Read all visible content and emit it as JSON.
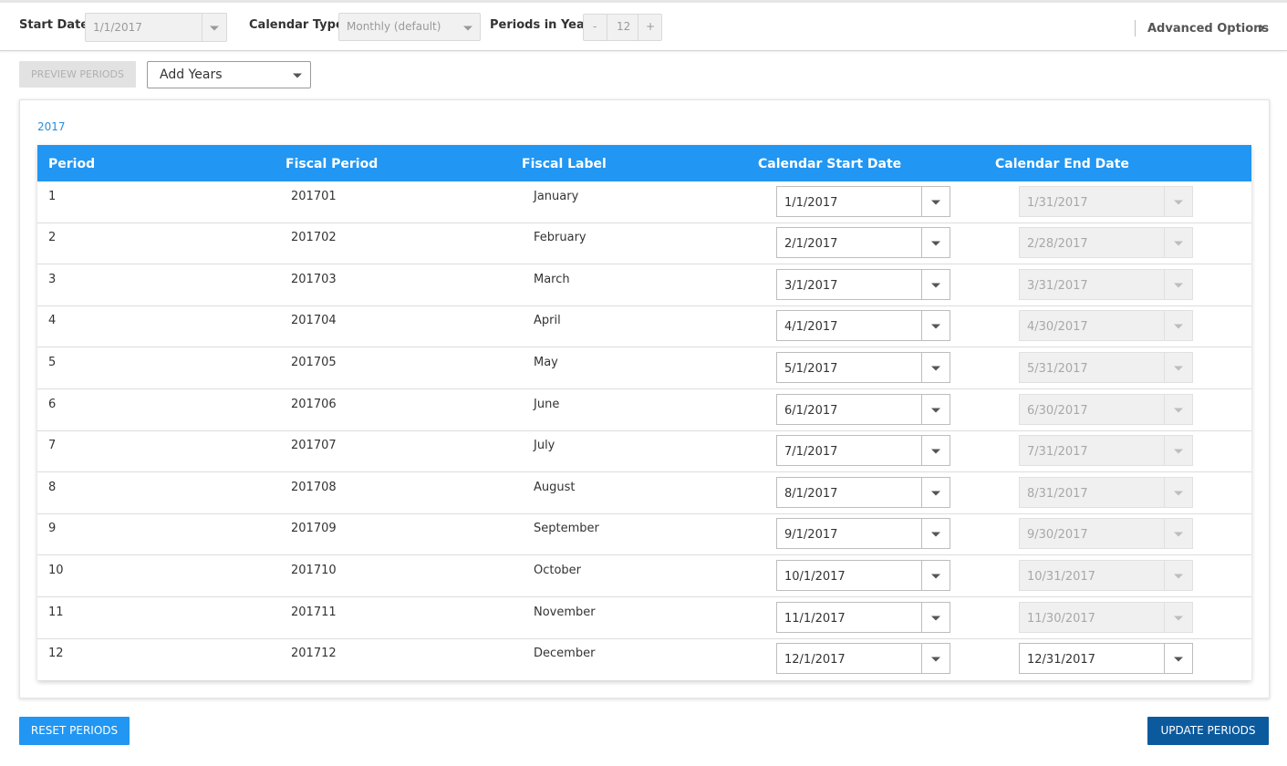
{
  "toolbar": {
    "start_date_label": "Start Date",
    "start_date_value": "1/1/2017",
    "calendar_type_label": "Calendar Type",
    "calendar_type_value": "Monthly (default)",
    "periods_label": "Periods in Year",
    "periods_minus": "-",
    "periods_value": "12",
    "periods_plus": "+",
    "advanced_options": "Advanced Options"
  },
  "actions": {
    "preview_label": "PREVIEW PERIODS",
    "add_years_value": "Add Years",
    "reset_label": "RESET PERIODS",
    "update_label": "UPDATE PERIODS"
  },
  "panel": {
    "year": "2017",
    "headers": {
      "period": "Period",
      "fiscal_period": "Fiscal Period",
      "fiscal_label": "Fiscal Label",
      "start_date": "Calendar Start Date",
      "end_date": "Calendar End Date"
    },
    "rows": [
      {
        "period": "1",
        "fiscal_period": "201701",
        "label": "January",
        "start": "1/1/2017",
        "end": "1/31/2017"
      },
      {
        "period": "2",
        "fiscal_period": "201702",
        "label": "February",
        "start": "2/1/2017",
        "end": "2/28/2017"
      },
      {
        "period": "3",
        "fiscal_period": "201703",
        "label": "March",
        "start": "3/1/2017",
        "end": "3/31/2017"
      },
      {
        "period": "4",
        "fiscal_period": "201704",
        "label": "April",
        "start": "4/1/2017",
        "end": "4/30/2017"
      },
      {
        "period": "5",
        "fiscal_period": "201705",
        "label": "May",
        "start": "5/1/2017",
        "end": "5/31/2017"
      },
      {
        "period": "6",
        "fiscal_period": "201706",
        "label": "June",
        "start": "6/1/2017",
        "end": "6/30/2017"
      },
      {
        "period": "7",
        "fiscal_period": "201707",
        "label": "July",
        "start": "7/1/2017",
        "end": "7/31/2017"
      },
      {
        "period": "8",
        "fiscal_period": "201708",
        "label": "August",
        "start": "8/1/2017",
        "end": "8/31/2017"
      },
      {
        "period": "9",
        "fiscal_period": "201709",
        "label": "September",
        "start": "9/1/2017",
        "end": "9/30/2017"
      },
      {
        "period": "10",
        "fiscal_period": "201710",
        "label": "October",
        "start": "10/1/2017",
        "end": "10/31/2017"
      },
      {
        "period": "11",
        "fiscal_period": "201711",
        "label": "November",
        "start": "11/1/2017",
        "end": "11/30/2017"
      },
      {
        "period": "12",
        "fiscal_period": "201712",
        "label": "December",
        "start": "12/1/2017",
        "end": "12/31/2017"
      }
    ]
  },
  "colors": {
    "header_blue": "#2196f3",
    "link_blue": "#2b8fd8",
    "update_button": "#0b5a9e"
  }
}
